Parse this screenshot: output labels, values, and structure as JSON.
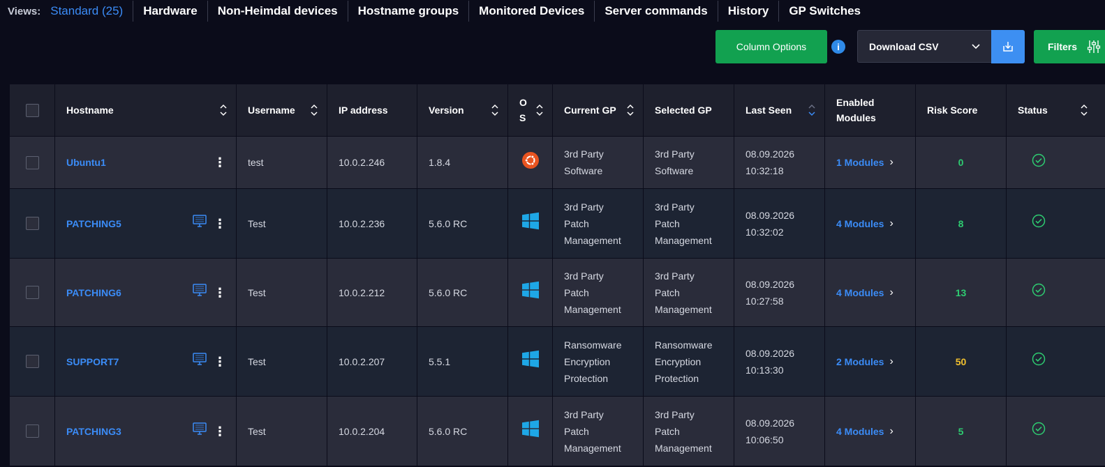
{
  "views": {
    "label": "Views:",
    "tabs": [
      {
        "label": "Standard (25)",
        "active": true
      },
      {
        "label": "Hardware"
      },
      {
        "label": "Non-Heimdal devices"
      },
      {
        "label": "Hostname groups"
      },
      {
        "label": "Monitored Devices"
      },
      {
        "label": "Server commands"
      },
      {
        "label": "History"
      },
      {
        "label": "GP Switches"
      }
    ]
  },
  "toolbar": {
    "column_options": "Column Options",
    "info": "i",
    "download_select": "Download CSV",
    "filters": "Filters"
  },
  "table": {
    "headers": {
      "hostname": "Hostname",
      "username": "Username",
      "ip": "IP address",
      "version": "Version",
      "os_line1": "O",
      "os_line2": "S",
      "current_gp": "Current GP",
      "selected_gp": "Selected GP",
      "last_seen": "Last Seen",
      "enabled_modules_line1": "Enabled",
      "enabled_modules_line2": "Modules",
      "risk_score": "Risk Score",
      "status": "Status"
    },
    "rows": [
      {
        "hostname": "Ubuntu1",
        "username": "test",
        "ip": "10.0.2.246",
        "version": "1.8.4",
        "os": "ubuntu",
        "current_gp": [
          "3rd Party",
          "Software"
        ],
        "selected_gp": [
          "3rd Party",
          "Software"
        ],
        "last_seen_date": "08.09.2026",
        "last_seen_time": "10:32:18",
        "modules": "1 Modules",
        "risk": "0",
        "risk_color": "#2ecc71",
        "status": "ok"
      },
      {
        "hostname": "PATCHING5",
        "username": "Test",
        "ip": "10.0.2.236",
        "version": "5.6.0 RC",
        "os": "windows",
        "current_gp": [
          "3rd Party",
          "Patch",
          "Management"
        ],
        "selected_gp": [
          "3rd Party",
          "Patch",
          "Management"
        ],
        "last_seen_date": "08.09.2026",
        "last_seen_time": "10:32:02",
        "modules": "4 Modules",
        "risk": "8",
        "risk_color": "#2ecc71",
        "status": "ok"
      },
      {
        "hostname": "PATCHING6",
        "username": "Test",
        "ip": "10.0.2.212",
        "version": "5.6.0 RC",
        "os": "windows",
        "current_gp": [
          "3rd Party",
          "Patch",
          "Management"
        ],
        "selected_gp": [
          "3rd Party",
          "Patch",
          "Management"
        ],
        "last_seen_date": "08.09.2026",
        "last_seen_time": "10:27:58",
        "modules": "4 Modules",
        "risk": "13",
        "risk_color": "#2ecc71",
        "status": "ok"
      },
      {
        "hostname": "SUPPORT7",
        "username": "Test",
        "ip": "10.0.2.207",
        "version": "5.5.1",
        "os": "windows",
        "current_gp": [
          "Ransomware",
          "Encryption",
          "Protection"
        ],
        "selected_gp": [
          "Ransomware",
          "Encryption",
          "Protection"
        ],
        "last_seen_date": "08.09.2026",
        "last_seen_time": "10:13:30",
        "modules": "2 Modules",
        "risk": "50",
        "risk_color": "#f2c12e",
        "status": "ok"
      },
      {
        "hostname": "PATCHING3",
        "username": "Test",
        "ip": "10.0.2.204",
        "version": "5.6.0 RC",
        "os": "windows",
        "current_gp": [
          "3rd Party",
          "Patch",
          "Management"
        ],
        "selected_gp": [
          "3rd Party",
          "Patch",
          "Management"
        ],
        "last_seen_date": "08.09.2026",
        "last_seen_time": "10:06:50",
        "modules": "4 Modules",
        "risk": "5",
        "risk_color": "#2ecc71",
        "status": "ok"
      }
    ]
  },
  "colors": {
    "accent": "#3b8cf7",
    "green_button": "#12a150",
    "status_ok": "#2ecc71",
    "windows": "#1ea7e6",
    "ubuntu": "#e95420"
  }
}
